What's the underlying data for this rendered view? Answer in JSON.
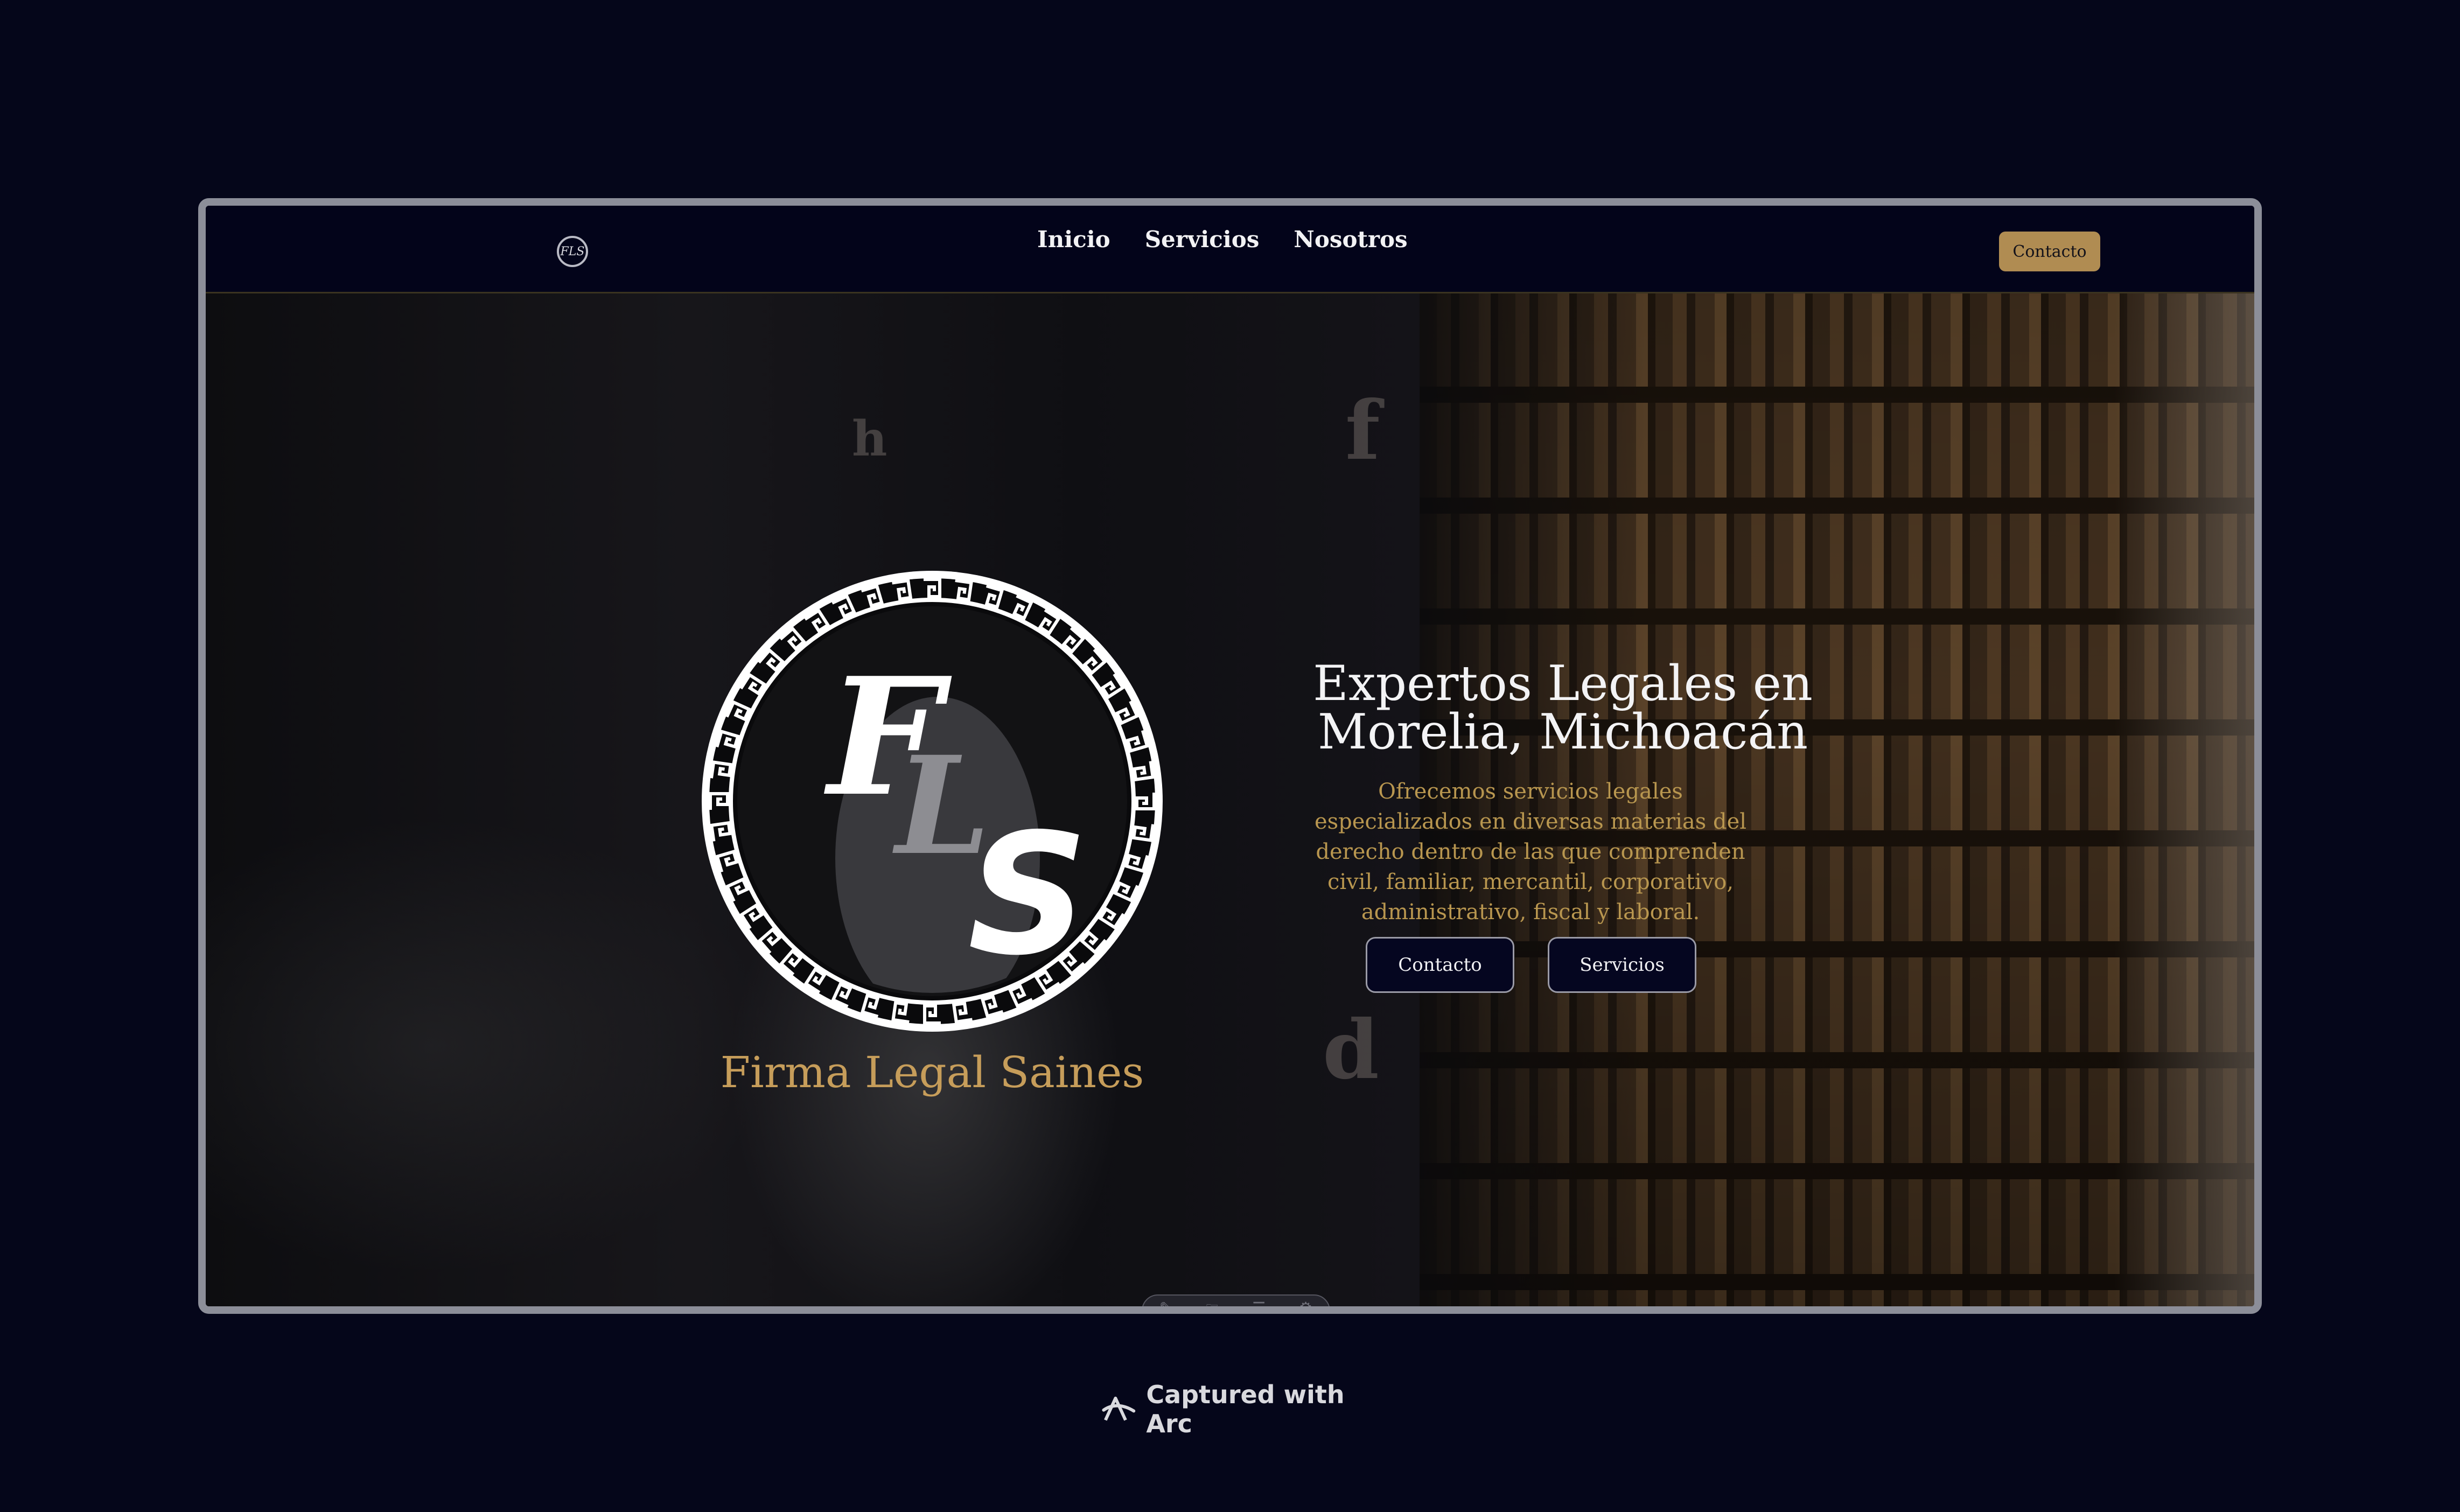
{
  "nav": {
    "logo_text": "FLS",
    "links": [
      "Inicio",
      "Servicios",
      "Nosotros"
    ],
    "cta": "Contacto"
  },
  "hero": {
    "emblem": {
      "letter_f": "F",
      "letter_l": "L",
      "letter_s": "S"
    },
    "firm_name": "Firma Legal Saines",
    "headline_line1": "Expertos Legales en",
    "headline_line2": "Morelia, Michoacán",
    "subtext": "Ofrecemos servicios legales especializados en diversas materias del derecho dentro de las que comprenden civil, familiar, mercantil, corporativo, administrativo, fiscal y laboral.",
    "buttons": {
      "contact": "Contacto",
      "services": "Servicios"
    },
    "deco_letters": [
      "h",
      "f",
      "d"
    ]
  },
  "footer": {
    "capture_label": "Captured with Arc"
  },
  "colors": {
    "background": "#05061a",
    "navbar": "#03041a",
    "gold": "#b08c52",
    "gold_text": "#c69d5a"
  }
}
